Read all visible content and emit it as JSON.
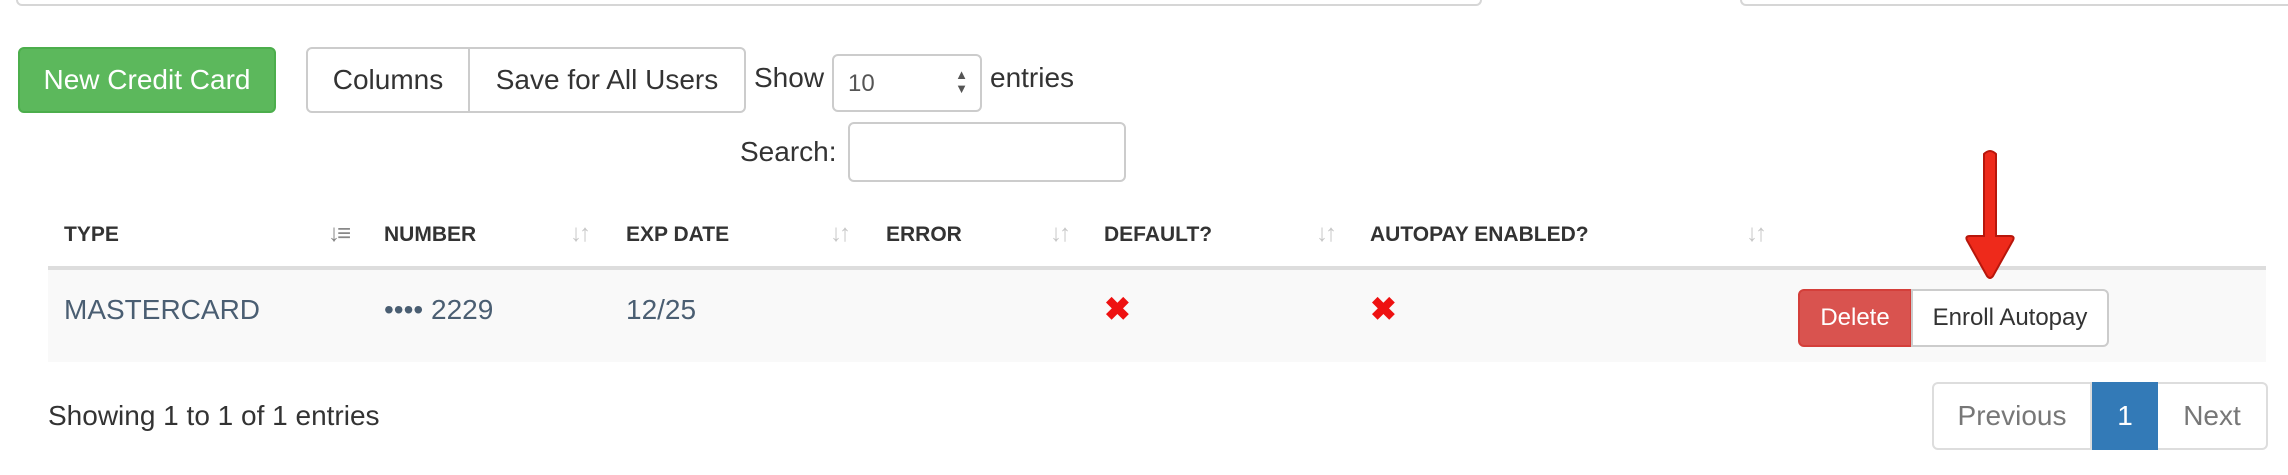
{
  "toolbar": {
    "new_label": "New Credit Card",
    "columns_label": "Columns",
    "save_label": "Save for All Users",
    "show_label": "Show",
    "page_size": "10",
    "entries_label": "entries",
    "search_label": "Search:",
    "search_value": ""
  },
  "table": {
    "headers": [
      "TYPE",
      "NUMBER",
      "EXP DATE",
      "ERROR",
      "DEFAULT?",
      "AUTOPAY ENABLED?"
    ],
    "sort_glyphs": [
      "↓≡",
      "↓↑",
      "↓↑",
      "↓↑",
      "↓↑",
      "↓↑"
    ],
    "rows": [
      {
        "type": "MASTERCARD",
        "number": "•••• 2229",
        "exp_date": "12/25",
        "error": "",
        "default": "✖",
        "autopay_enabled": "✖",
        "actions": {
          "delete_label": "Delete",
          "enroll_label": "Enroll Autopay"
        }
      }
    ]
  },
  "footer": {
    "info": "Showing 1 to 1 of 1 entries",
    "pagination": {
      "previous": "Previous",
      "current": "1",
      "next": "Next"
    }
  },
  "annotation": {
    "icon": "red-down-arrow-icon",
    "color": "#ee2a1b"
  },
  "colors": {
    "success": "#5cb85c",
    "danger": "#d9534f",
    "primary": "#337ab7",
    "link_text": "#4a5e72",
    "x_mark": "#ee1111"
  }
}
